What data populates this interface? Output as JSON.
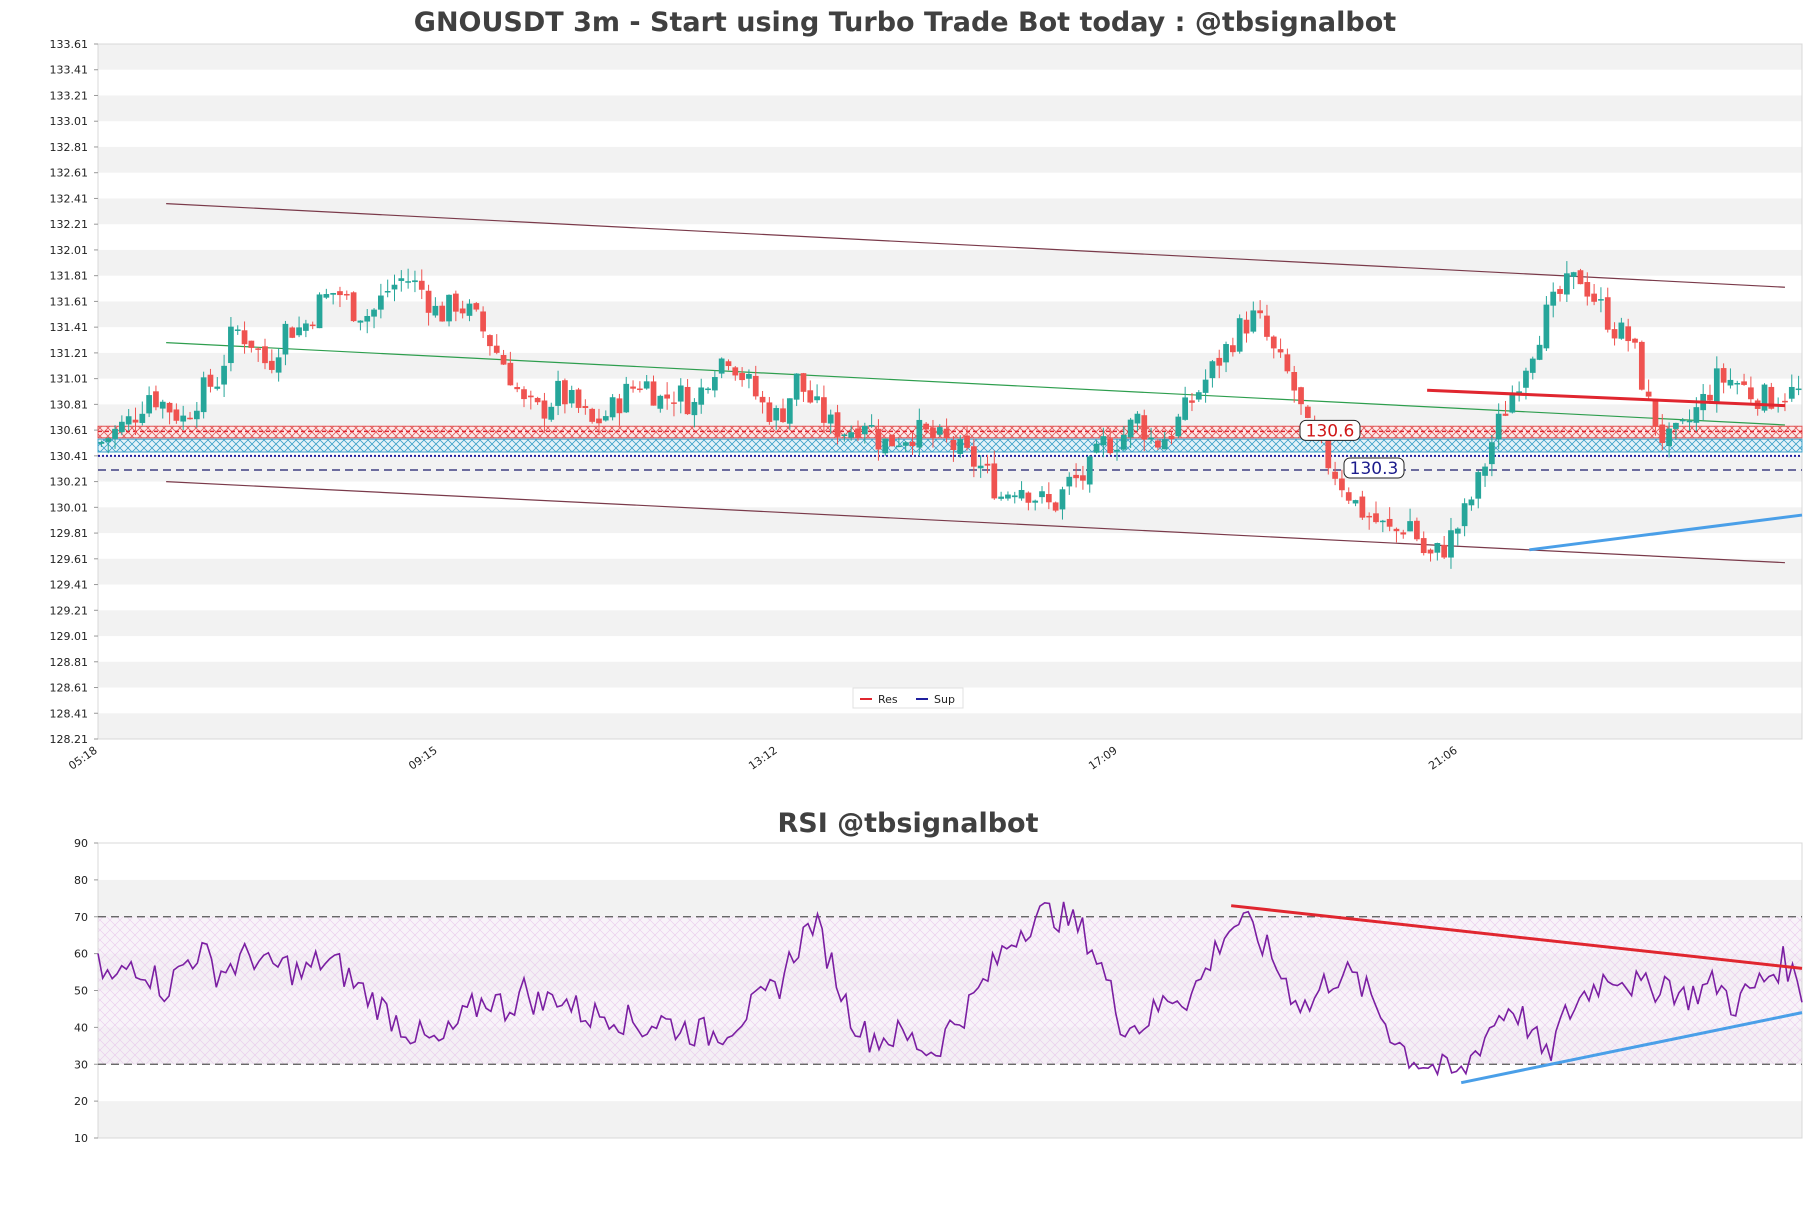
{
  "chart_data": [
    {
      "type": "candlestick",
      "title": "GNOUSDT 3m - Start using Turbo Trade Bot today : @tbsignalbot",
      "ylim": [
        128.21,
        133.61
      ],
      "y_ticks": [
        "133.61",
        "133.41",
        "133.21",
        "133.01",
        "132.81",
        "132.61",
        "132.41",
        "132.21",
        "132.01",
        "131.81",
        "131.61",
        "131.41",
        "131.21",
        "131.01",
        "130.81",
        "130.61",
        "130.41",
        "130.21",
        "130.01",
        "129.81",
        "129.61",
        "129.41",
        "129.21",
        "129.01",
        "128.81",
        "128.61",
        "128.41",
        "128.21"
      ],
      "x_ticks": [
        "05:18",
        "09:15",
        "13:12",
        "17:09",
        "21:06"
      ],
      "grid": "horizontal bands",
      "legend": {
        "placement": "bottom-center",
        "entries": [
          {
            "name": "Res",
            "color": "#e0262f"
          },
          {
            "name": "Sup",
            "color": "#1f1f9e"
          }
        ]
      },
      "annotations": [
        {
          "text": "130.6",
          "value": 130.6,
          "color": "#d01818"
        },
        {
          "text": "130.3",
          "value": 130.3,
          "color": "#1c1c8c"
        }
      ],
      "levels": {
        "resistance": 130.6,
        "support": 130.3,
        "support_line": 130.41,
        "zone_top": [
          130.55,
          130.64
        ],
        "zone_bottom": [
          130.44,
          130.54
        ]
      },
      "channel": {
        "upper": [
          [
            0.04,
            132.37
          ],
          [
            0.99,
            131.72
          ]
        ],
        "lower": [
          [
            0.04,
            130.21
          ],
          [
            0.99,
            129.58
          ]
        ],
        "mid": [
          [
            0.04,
            131.29
          ],
          [
            0.99,
            130.65
          ]
        ]
      },
      "trendlines": [
        {
          "kind": "resistance",
          "from": [
            0.78,
            130.92
          ],
          "to": [
            0.99,
            130.8
          ],
          "color": "#e0262f"
        },
        {
          "kind": "support",
          "from": [
            0.84,
            129.68
          ],
          "to": [
            1.0,
            129.95
          ],
          "color": "#4a9fe8"
        }
      ],
      "close_path": [
        [
          0.0,
          130.5
        ],
        [
          0.02,
          130.7
        ],
        [
          0.03,
          130.9
        ],
        [
          0.05,
          130.7
        ],
        [
          0.06,
          130.9
        ],
        [
          0.07,
          131.0
        ],
        [
          0.08,
          131.4
        ],
        [
          0.09,
          131.3
        ],
        [
          0.1,
          131.1
        ],
        [
          0.11,
          131.4
        ],
        [
          0.12,
          131.4
        ],
        [
          0.13,
          131.6
        ],
        [
          0.14,
          131.7
        ],
        [
          0.15,
          131.55
        ],
        [
          0.16,
          131.5
        ],
        [
          0.17,
          131.7
        ],
        [
          0.18,
          131.8
        ],
        [
          0.19,
          131.7
        ],
        [
          0.2,
          131.5
        ],
        [
          0.21,
          131.6
        ],
        [
          0.22,
          131.5
        ],
        [
          0.23,
          131.3
        ],
        [
          0.24,
          131.1
        ],
        [
          0.25,
          130.8
        ],
        [
          0.26,
          130.75
        ],
        [
          0.27,
          130.9
        ],
        [
          0.28,
          130.8
        ],
        [
          0.29,
          130.65
        ],
        [
          0.3,
          130.75
        ],
        [
          0.31,
          130.9
        ],
        [
          0.32,
          131.0
        ],
        [
          0.33,
          130.85
        ],
        [
          0.34,
          130.9
        ],
        [
          0.35,
          130.8
        ],
        [
          0.36,
          131.1
        ],
        [
          0.37,
          131.2
        ],
        [
          0.38,
          131.0
        ],
        [
          0.39,
          130.8
        ],
        [
          0.4,
          130.7
        ],
        [
          0.41,
          131.0
        ],
        [
          0.42,
          130.8
        ],
        [
          0.43,
          130.65
        ],
        [
          0.44,
          130.6
        ],
        [
          0.45,
          130.7
        ],
        [
          0.46,
          130.5
        ],
        [
          0.47,
          130.55
        ],
        [
          0.48,
          130.6
        ],
        [
          0.49,
          130.55
        ],
        [
          0.5,
          130.5
        ],
        [
          0.51,
          130.4
        ],
        [
          0.52,
          130.3
        ],
        [
          0.53,
          130.1
        ],
        [
          0.54,
          130.2
        ],
        [
          0.55,
          130.1
        ],
        [
          0.56,
          130.0
        ],
        [
          0.57,
          130.2
        ],
        [
          0.58,
          130.25
        ],
        [
          0.59,
          130.5
        ],
        [
          0.6,
          130.55
        ],
        [
          0.61,
          130.7
        ],
        [
          0.62,
          130.5
        ],
        [
          0.63,
          130.6
        ],
        [
          0.64,
          130.8
        ],
        [
          0.65,
          131.0
        ],
        [
          0.66,
          131.2
        ],
        [
          0.67,
          131.4
        ],
        [
          0.68,
          131.5
        ],
        [
          0.69,
          131.2
        ],
        [
          0.7,
          131.0
        ],
        [
          0.71,
          130.6
        ],
        [
          0.72,
          130.4
        ],
        [
          0.73,
          130.2
        ],
        [
          0.74,
          130.0
        ],
        [
          0.75,
          129.9
        ],
        [
          0.76,
          129.8
        ],
        [
          0.77,
          129.9
        ],
        [
          0.78,
          129.6
        ],
        [
          0.79,
          129.7
        ],
        [
          0.8,
          129.9
        ],
        [
          0.81,
          130.2
        ],
        [
          0.82,
          130.6
        ],
        [
          0.83,
          130.9
        ],
        [
          0.84,
          131.2
        ],
        [
          0.85,
          131.5
        ],
        [
          0.86,
          131.7
        ],
        [
          0.87,
          131.8
        ],
        [
          0.88,
          131.6
        ],
        [
          0.89,
          131.4
        ],
        [
          0.9,
          131.3
        ],
        [
          0.91,
          130.8
        ],
        [
          0.92,
          130.5
        ],
        [
          0.93,
          130.6
        ],
        [
          0.94,
          130.8
        ],
        [
          0.95,
          131.0
        ],
        [
          0.96,
          131.0
        ],
        [
          0.97,
          130.9
        ],
        [
          0.98,
          130.85
        ],
        [
          0.99,
          130.9
        ],
        [
          1.0,
          130.9
        ]
      ],
      "candle_count": 250,
      "up_color": "#26a69a",
      "down_color": "#ef5350"
    },
    {
      "type": "line",
      "title": "RSI @tbsignalbot",
      "ylim": [
        10,
        90
      ],
      "y_ticks": [
        "90",
        "80",
        "70",
        "60",
        "50",
        "40",
        "30",
        "20",
        "10"
      ],
      "overbought": 70,
      "oversold": 30,
      "band": [
        40,
        60
      ],
      "line_color": "#7b1fa2",
      "trendlines": [
        {
          "kind": "resistance",
          "from": [
            0.665,
            73
          ],
          "to": [
            1.0,
            56
          ],
          "color": "#e0262f"
        },
        {
          "kind": "support",
          "from": [
            0.8,
            25
          ],
          "to": [
            1.0,
            44
          ],
          "color": "#4a9fe8"
        }
      ],
      "series": [
        [
          0.0,
          56
        ],
        [
          0.01,
          52
        ],
        [
          0.02,
          58
        ],
        [
          0.03,
          55
        ],
        [
          0.04,
          50
        ],
        [
          0.05,
          57
        ],
        [
          0.06,
          61
        ],
        [
          0.07,
          55
        ],
        [
          0.08,
          57
        ],
        [
          0.09,
          60
        ],
        [
          0.1,
          56
        ],
        [
          0.11,
          57
        ],
        [
          0.12,
          54
        ],
        [
          0.13,
          58
        ],
        [
          0.14,
          57
        ],
        [
          0.15,
          52
        ],
        [
          0.16,
          48
        ],
        [
          0.17,
          44
        ],
        [
          0.18,
          40
        ],
        [
          0.19,
          37
        ],
        [
          0.2,
          35
        ],
        [
          0.21,
          40
        ],
        [
          0.22,
          45
        ],
        [
          0.23,
          48
        ],
        [
          0.24,
          45
        ],
        [
          0.25,
          50
        ],
        [
          0.26,
          46
        ],
        [
          0.27,
          49
        ],
        [
          0.28,
          45
        ],
        [
          0.29,
          43
        ],
        [
          0.3,
          44
        ],
        [
          0.31,
          42
        ],
        [
          0.32,
          40
        ],
        [
          0.33,
          42
        ],
        [
          0.34,
          40
        ],
        [
          0.35,
          39
        ],
        [
          0.36,
          38
        ],
        [
          0.37,
          40
        ],
        [
          0.38,
          44
        ],
        [
          0.39,
          47
        ],
        [
          0.4,
          52
        ],
        [
          0.41,
          62
        ],
        [
          0.42,
          69
        ],
        [
          0.43,
          58
        ],
        [
          0.44,
          45
        ],
        [
          0.45,
          38
        ],
        [
          0.46,
          37
        ],
        [
          0.47,
          38
        ],
        [
          0.48,
          36
        ],
        [
          0.49,
          33
        ],
        [
          0.5,
          40
        ],
        [
          0.51,
          45
        ],
        [
          0.52,
          52
        ],
        [
          0.53,
          60
        ],
        [
          0.54,
          66
        ],
        [
          0.55,
          70
        ],
        [
          0.56,
          71
        ],
        [
          0.57,
          69
        ],
        [
          0.58,
          65
        ],
        [
          0.59,
          55
        ],
        [
          0.6,
          42
        ],
        [
          0.61,
          40
        ],
        [
          0.62,
          44
        ],
        [
          0.63,
          49
        ],
        [
          0.64,
          48
        ],
        [
          0.65,
          55
        ],
        [
          0.66,
          65
        ],
        [
          0.67,
          69
        ],
        [
          0.68,
          65
        ],
        [
          0.69,
          58
        ],
        [
          0.7,
          50
        ],
        [
          0.71,
          45
        ],
        [
          0.72,
          52
        ],
        [
          0.73,
          55
        ],
        [
          0.74,
          52
        ],
        [
          0.75,
          46
        ],
        [
          0.76,
          38
        ],
        [
          0.77,
          32
        ],
        [
          0.78,
          30
        ],
        [
          0.79,
          28
        ],
        [
          0.8,
          27
        ],
        [
          0.81,
          35
        ],
        [
          0.82,
          42
        ],
        [
          0.83,
          46
        ],
        [
          0.84,
          40
        ],
        [
          0.85,
          31
        ],
        [
          0.86,
          42
        ],
        [
          0.87,
          48
        ],
        [
          0.88,
          52
        ],
        [
          0.89,
          55
        ],
        [
          0.9,
          52
        ],
        [
          0.91,
          50
        ],
        [
          0.92,
          53
        ],
        [
          0.93,
          48
        ],
        [
          0.94,
          50
        ],
        [
          0.95,
          52
        ],
        [
          0.96,
          46
        ],
        [
          0.97,
          50
        ],
        [
          0.98,
          54
        ],
        [
          0.99,
          58
        ],
        [
          1.0,
          50
        ]
      ]
    }
  ]
}
